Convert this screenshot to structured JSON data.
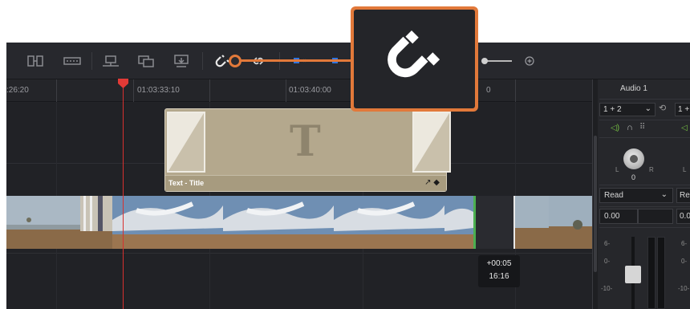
{
  "toolbar": {
    "icons": [
      "trim-edit-icon",
      "dynamic-trim-icon",
      "overwrite-clip-icon",
      "replace-clip-icon",
      "place-on-top-icon",
      "snapping-icon",
      "linked-selection-icon",
      "flag-icon",
      "marker-icon",
      "zoom-in-icon"
    ],
    "active_snapping": true
  },
  "ruler": {
    "timecodes": [
      ":26:20",
      "01:03:33:10",
      "01:03:40:00",
      "0"
    ]
  },
  "timeline": {
    "title_clip": {
      "label": "Text - Title",
      "glyph": "T"
    },
    "trim_tooltip": {
      "offset": "+00:05",
      "duration": "16:16"
    }
  },
  "mixer": {
    "channel_name": "Audio 1",
    "input": "1 + 2",
    "input_next": "1 +",
    "pan_left": "L",
    "pan_right": "R",
    "pan_value": "0",
    "automation": "Read",
    "automation_next": "Re",
    "gain": "0.00",
    "gain_next": "0.0",
    "meter_marks": [
      "6-",
      "0-",
      "-10-"
    ]
  },
  "callout": {
    "icon": "snapping-magnet-icon"
  },
  "colors": {
    "accent": "#e2793a",
    "playhead": "#d8312f",
    "title_clip": "#b4a88d",
    "green_edge": "#4caf50",
    "toolbar_blue": "#2f74e0"
  }
}
